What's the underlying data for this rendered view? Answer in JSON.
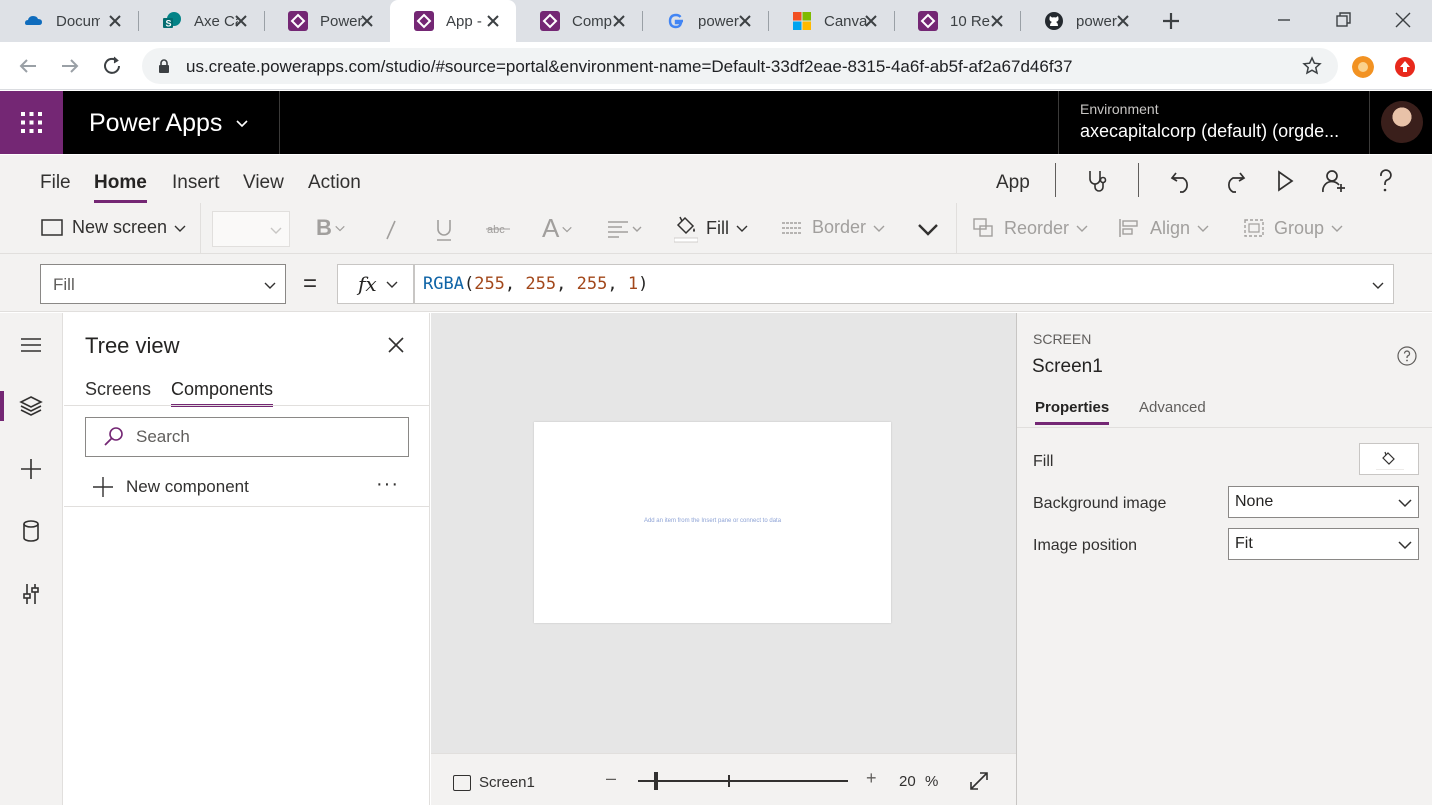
{
  "browser": {
    "tabs": [
      {
        "title": "Docum",
        "icon": "onedrive-icon"
      },
      {
        "title": "Axe Ca",
        "icon": "sharepoint-icon"
      },
      {
        "title": "Power",
        "icon": "powerapps-icon"
      },
      {
        "title": "App -",
        "icon": "powerapps-icon"
      },
      {
        "title": "Comp",
        "icon": "powerapps-icon"
      },
      {
        "title": "power",
        "icon": "google-icon"
      },
      {
        "title": "Canva",
        "icon": "microsoft-icon"
      },
      {
        "title": "10 Re",
        "icon": "powerapps-icon"
      },
      {
        "title": "power",
        "icon": "github-icon"
      }
    ],
    "url": "us.create.powerapps.com/studio/#source=portal&environment-name=Default-33df2eae-8315-4a6f-ab5f-af2a67d46f37"
  },
  "header": {
    "app_name": "Power Apps",
    "environment_label": "Environment",
    "environment_name": "axecapitalcorp (default) (orgde..."
  },
  "menu": {
    "items": [
      "File",
      "Home",
      "Insert",
      "View",
      "Action"
    ],
    "active": "Home",
    "app_label": "App"
  },
  "ribbon": {
    "new_screen": "New screen",
    "fill": "Fill",
    "border": "Border",
    "reorder": "Reorder",
    "align": "Align",
    "group": "Group"
  },
  "formula": {
    "property": "Fill",
    "equals": "=",
    "fx": "fx",
    "fn": "RGBA",
    "args": [
      "255",
      "255",
      "255",
      "1"
    ]
  },
  "tree": {
    "title": "Tree view",
    "tabs": [
      "Screens",
      "Components"
    ],
    "active_tab": "Components",
    "search_placeholder": "Search",
    "new_component": "New component",
    "more": "···"
  },
  "canvas": {
    "hint": "Add an item from the Insert pane or connect to data",
    "screen_name": "Screen1",
    "zoom_value": "20",
    "zoom_unit": "%"
  },
  "properties": {
    "kind": "SCREEN",
    "name": "Screen1",
    "tabs": [
      "Properties",
      "Advanced"
    ],
    "active_tab": "Properties",
    "fill_label": "Fill",
    "bg_image_label": "Background image",
    "bg_image_value": "None",
    "image_position_label": "Image position",
    "image_position_value": "Fit"
  },
  "colors": {
    "brand": "#742774",
    "header_bg": "#000000",
    "pane_bg": "#f3f2f1"
  }
}
